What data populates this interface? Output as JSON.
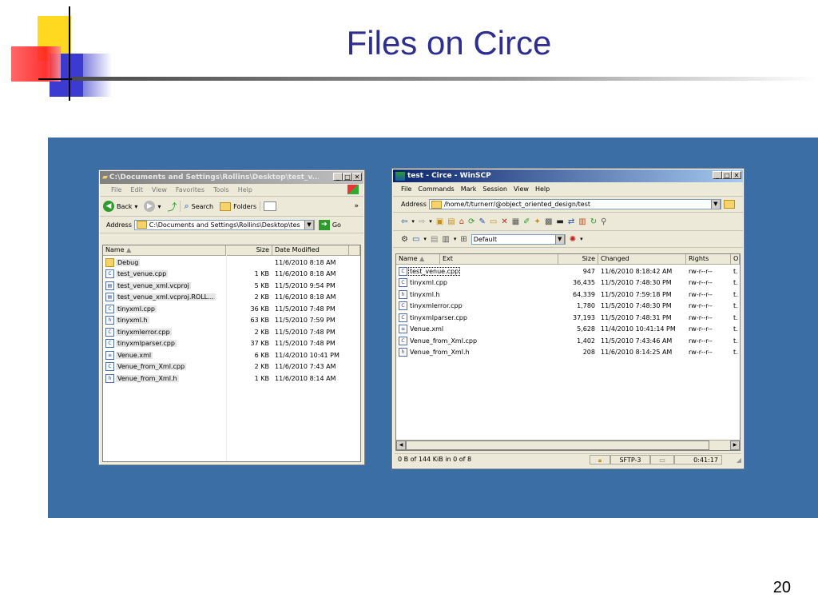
{
  "slide": {
    "title": "Files on Circe",
    "page_number": "20"
  },
  "explorer": {
    "title": "C:\\Documents and Settings\\Rollins\\Desktop\\test_v...",
    "menu": [
      "File",
      "Edit",
      "View",
      "Favorites",
      "Tools",
      "Help"
    ],
    "toolbar": {
      "back": "Back",
      "search": "Search",
      "folders": "Folders",
      "more": "»"
    },
    "address_label": "Address",
    "address_value": "C:\\Documents and Settings\\Rollins\\Desktop\\tes",
    "go_label": "Go",
    "columns": [
      "Name",
      "Size",
      "Date Modified"
    ],
    "files": [
      {
        "name": "Debug",
        "size": "",
        "date": "11/6/2010 8:18 AM",
        "icon": "folder-icon"
      },
      {
        "name": "test_venue.cpp",
        "size": "1 KB",
        "date": "11/6/2010 8:18 AM",
        "icon": "cpp-file-icon"
      },
      {
        "name": "test_venue_xml.vcproj",
        "size": "5 KB",
        "date": "11/5/2010 9:54 PM",
        "icon": "project-file-icon"
      },
      {
        "name": "test_venue_xml.vcproj.ROLL...",
        "size": "2 KB",
        "date": "11/6/2010 8:18 AM",
        "icon": "project-file-icon"
      },
      {
        "name": "tinyxml.cpp",
        "size": "36 KB",
        "date": "11/5/2010 7:48 PM",
        "icon": "cpp-file-icon"
      },
      {
        "name": "tinyxml.h",
        "size": "63 KB",
        "date": "11/5/2010 7:59 PM",
        "icon": "header-file-icon"
      },
      {
        "name": "tinyxmlerror.cpp",
        "size": "2 KB",
        "date": "11/5/2010 7:48 PM",
        "icon": "cpp-file-icon"
      },
      {
        "name": "tinyxmlparser.cpp",
        "size": "37 KB",
        "date": "11/5/2010 7:48 PM",
        "icon": "cpp-file-icon"
      },
      {
        "name": "Venue.xml",
        "size": "6 KB",
        "date": "11/4/2010 10:41 PM",
        "icon": "xml-file-icon"
      },
      {
        "name": "Venue_from_Xml.cpp",
        "size": "2 KB",
        "date": "11/6/2010 7:43 AM",
        "icon": "cpp-file-icon"
      },
      {
        "name": "Venue_from_Xml.h",
        "size": "1 KB",
        "date": "11/6/2010 8:14 AM",
        "icon": "header-file-icon"
      }
    ]
  },
  "winscp": {
    "title": "test - Circe - WinSCP",
    "menu": [
      "File",
      "Commands",
      "Mark",
      "Session",
      "View",
      "Help"
    ],
    "address_label": "Address",
    "address_value": "/home/t/turnerr/@object_oriented_design/test",
    "profile_value": "Default",
    "columns": [
      "Name",
      "Ext",
      "Size",
      "Changed",
      "Rights",
      "O"
    ],
    "files": [
      {
        "name": "test_venue.cpp",
        "size": "947",
        "changed": "11/6/2010 8:18:42 AM",
        "rights": "rw-r--r--",
        "owner": "t.",
        "icon": "cpp-file-icon"
      },
      {
        "name": "tinyxml.cpp",
        "size": "36,435",
        "changed": "11/5/2010 7:48:30 PM",
        "rights": "rw-r--r--",
        "owner": "t.",
        "icon": "cpp-file-icon"
      },
      {
        "name": "tinyxml.h",
        "size": "64,339",
        "changed": "11/5/2010 7:59:18 PM",
        "rights": "rw-r--r--",
        "owner": "t.",
        "icon": "header-file-icon"
      },
      {
        "name": "tinyxmlerror.cpp",
        "size": "1,780",
        "changed": "11/5/2010 7:48:30 PM",
        "rights": "rw-r--r--",
        "owner": "t.",
        "icon": "cpp-file-icon"
      },
      {
        "name": "tinyxmlparser.cpp",
        "size": "37,193",
        "changed": "11/5/2010 7:48:31 PM",
        "rights": "rw-r--r--",
        "owner": "t.",
        "icon": "cpp-file-icon"
      },
      {
        "name": "Venue.xml",
        "size": "5,628",
        "changed": "11/4/2010 10:41:14 PM",
        "rights": "rw-r--r--",
        "owner": "t.",
        "icon": "xml-file-icon"
      },
      {
        "name": "Venue_from_Xml.cpp",
        "size": "1,402",
        "changed": "11/5/2010 7:43:46 AM",
        "rights": "rw-r--r--",
        "owner": "t.",
        "icon": "cpp-file-icon"
      },
      {
        "name": "Venue_from_Xml.h",
        "size": "208",
        "changed": "11/6/2010 8:14:25 AM",
        "rights": "rw-r--r--",
        "owner": "t.",
        "icon": "header-file-icon"
      }
    ],
    "status": {
      "selection": "0 B of 144 KiB in 0 of 8",
      "protocol": "SFTP-3",
      "time": "0:41:17"
    }
  }
}
